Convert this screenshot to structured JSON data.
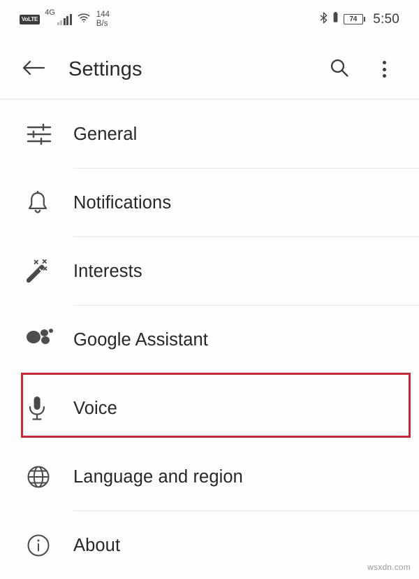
{
  "status_bar": {
    "volte_label": "VoLTE",
    "network_type": "4G",
    "signal_icon": "cellular-signal-icon",
    "wifi_icon": "wifi-icon",
    "data_rate_value": "144",
    "data_rate_unit": "B/s",
    "bluetooth_icon": "bluetooth-icon",
    "vibrate_icon": "vibrate-icon",
    "battery_level": "74",
    "time": "5:50"
  },
  "app_bar": {
    "back_icon": "arrow-back-icon",
    "title": "Settings",
    "search_icon": "search-icon",
    "overflow_icon": "more-vert-icon"
  },
  "settings": {
    "items": [
      {
        "label": "General",
        "icon": "tune-sliders-icon",
        "highlighted": false
      },
      {
        "label": "Notifications",
        "icon": "bell-icon",
        "highlighted": false
      },
      {
        "label": "Interests",
        "icon": "magic-wand-icon",
        "highlighted": false
      },
      {
        "label": "Google Assistant",
        "icon": "assistant-dots-icon",
        "highlighted": false
      },
      {
        "label": "Voice",
        "icon": "microphone-icon",
        "highlighted": true
      },
      {
        "label": "Language and region",
        "icon": "globe-icon",
        "highlighted": false
      },
      {
        "label": "About",
        "icon": "info-circle-icon",
        "highlighted": false
      }
    ]
  },
  "annotation": {
    "highlight_color": "#c22a37",
    "target_label": "Voice"
  },
  "watermark": {
    "text": "wsxdn.com"
  },
  "colors": {
    "background": "#fdfdfd",
    "text_primary": "#272727",
    "icon": "#4a4a4a",
    "divider": "#e8e8e8",
    "accent_red": "#c22a37"
  }
}
